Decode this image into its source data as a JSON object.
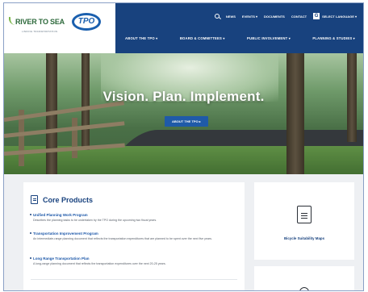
{
  "header": {
    "logo": {
      "name": "RIVER TO SEA",
      "badge": "TPO",
      "tagline": "LINKING TRANSPORTATION"
    },
    "utility_nav": [
      "NEWS",
      "EVENTS ▾",
      "DOCUMENTS",
      "CONTACT"
    ],
    "translate_label": "SELECT LANGUAGE ▾",
    "main_nav": [
      "ABOUT THE TPO ▾",
      "BOARD & COMMITTEES ▾",
      "PUBLIC INVOLVEMENT ▾",
      "PLANNING & STUDIES ▾"
    ]
  },
  "hero": {
    "headline": "Vision. Plan. Implement.",
    "button_label": "ABOUT THE TPO ▸"
  },
  "core_products": {
    "title": "Core Products",
    "items": [
      {
        "title": "Unified Planning Work Program",
        "description": "Describes the planning tasks to be undertaken by the TPO during the upcoming two fiscal years."
      },
      {
        "title": "Transportation Improvement Program",
        "description": "An intermediate-range planning document that reflects the transportation expenditures that are planned to be spent over the next five years."
      },
      {
        "title": "Long Range Transportation Plan",
        "description": "A long-range planning document that reflects the transportation expenditures over the next 20-25 years."
      }
    ]
  },
  "side_cards": [
    {
      "label": "Bicycle Suitability Maps",
      "icon": "document-icon"
    }
  ],
  "colors": {
    "navy": "#18427e",
    "link_blue": "#1a56a8",
    "button_blue": "#1f5aa8",
    "content_bg": "#eef0f3"
  }
}
